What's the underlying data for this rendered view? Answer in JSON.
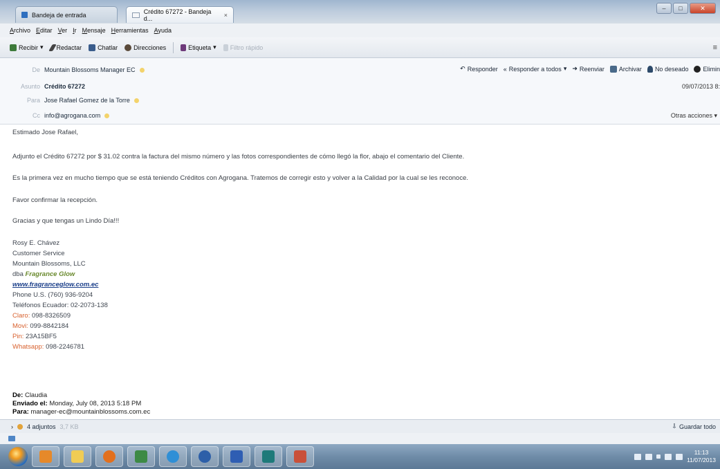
{
  "tabs": [
    {
      "label": "Bandeja de entrada"
    },
    {
      "label": "Crédito 67272 - Bandeja d...",
      "close": "×"
    }
  ],
  "window_controls": {
    "minimize": "–",
    "maximize": "□",
    "close": "✕"
  },
  "menu": [
    "Archivo",
    "Editar",
    "Ver",
    "Ir",
    "Mensaje",
    "Herramientas",
    "Ayuda"
  ],
  "toolbar": {
    "receive": "Recibir",
    "receive_arrow": "▾",
    "compose": "Redactar",
    "chat": "Chatlar",
    "addresses": "Direcciones",
    "tag": "Etiqueta",
    "tag_arrow": "▾",
    "quick_filter": "Filtro rápido",
    "menu_icon": "≡"
  },
  "header": {
    "from_label": "De",
    "from": "Mountain Blossoms Manager EC",
    "subject_label": "Asunto",
    "subject": "Crédito 67272",
    "to_label": "Para",
    "to": "Jose Rafael Gomez de la Torre",
    "cc_label": "Cc",
    "cc": "info@agrogana.com",
    "date": "09/07/2013 8:",
    "more_actions": "Otras acciones",
    "more_arrow": "▾",
    "actions": {
      "reply": "Responder",
      "reply_all": "Responder a todos",
      "reply_all_arrow": "▾",
      "forward": "Reenviar",
      "archive": "Archivar",
      "junk": "No deseado",
      "delete": "Elimin"
    }
  },
  "body": {
    "greeting": "Estimado Jose Rafael,",
    "p1": "Adjunto el Crédito 67272 por $ 31.02 contra la factura del mismo número y las fotos correspondientes de cómo llegó la flor, abajo el comentario del Cliente.",
    "p2": "Es la primera vez en mucho tiempo que se está teniendo Créditos con Agrogana. Tratemos de corregir esto y volver a la Calidad por la cual se les reconoce.",
    "p3": "Favor confirmar la recepción.",
    "p4": "Gracias y que tengas un Lindo Día!!!"
  },
  "signature": {
    "name": "Rosy E. Chávez",
    "role": "Customer Service",
    "company": "Mountain Blossoms, LLC",
    "dba_prefix": "dba",
    "dba_name": "Fragrance Glow",
    "website": "www.fragranceglow.com.ec",
    "phone_us": "Phone U.S. (760) 936-9204",
    "phone_ec": "Teléfonos Ecuador: 02-2073-138",
    "claro_label": "Claro:",
    "claro": "098-8326509",
    "movi_label": "Movi:",
    "movi": "099-8842184",
    "pin_label": "Pin:",
    "pin": "23A15BF5",
    "whatsapp_label": "Whatsapp:",
    "whatsapp": "098-2246781"
  },
  "quoted": {
    "from_label": "De:",
    "from": "Claudia",
    "sent_label": "Enviado el:",
    "sent": "Monday, July 08, 2013 5:18 PM",
    "to_label": "Para:",
    "to": "manager-ec@mountainblossoms.com.ec"
  },
  "attachments": {
    "count": "4 adjuntos",
    "size": "3,7 KB",
    "save_all": "Guardar todo"
  },
  "taskbar": {
    "time": "11:13",
    "date": "11/07/2013"
  },
  "colors": {
    "link": "#1b3f8a",
    "dba": "#6a8a2e",
    "label_orange": "#d8612e"
  }
}
